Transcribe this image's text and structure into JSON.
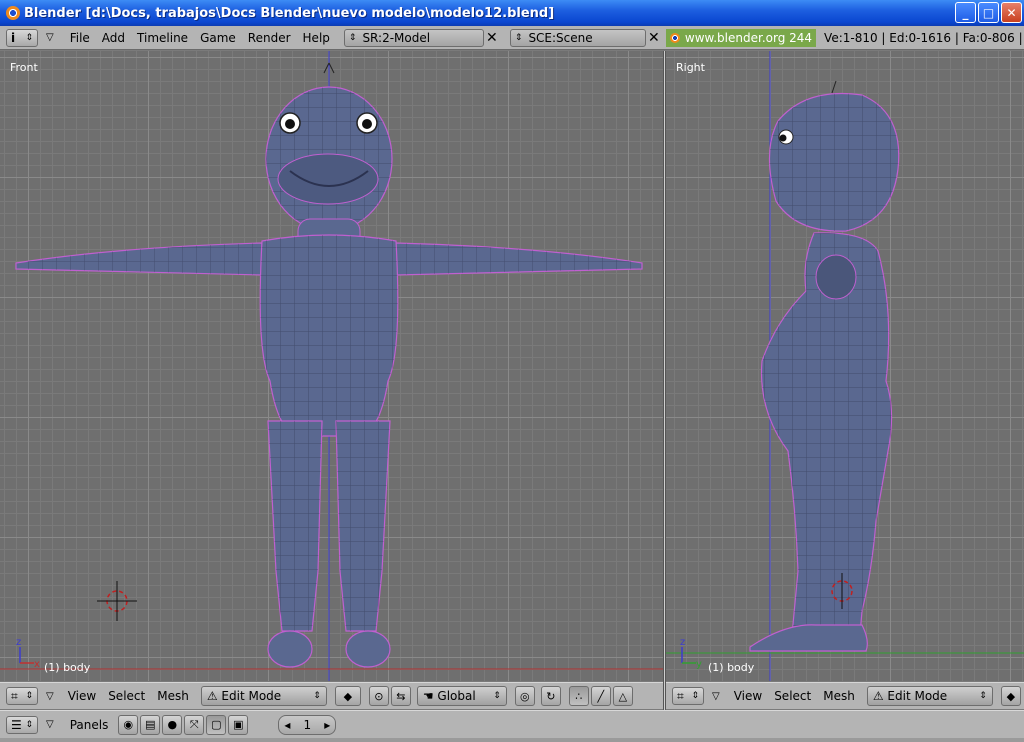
{
  "window": {
    "title": "Blender [d:\\Docs, trabajos\\Docs Blender\\nuevo modelo\\modelo12.blend]",
    "minimize": "_",
    "maximize": "□",
    "close": "✕"
  },
  "topheader": {
    "info_icon": "i",
    "menus": [
      "File",
      "Add",
      "Timeline",
      "Game",
      "Render",
      "Help"
    ],
    "screen_field": "SR:2-Model",
    "scene_field": "SCE:Scene",
    "url": "www.blender.org 244",
    "stats": "Ve:1-810 | Ed:0-1616 | Fa:0-806 |"
  },
  "viewports": {
    "front": {
      "label": "Front",
      "object": "(1) body"
    },
    "right": {
      "label": "Right",
      "object": "(1) body"
    }
  },
  "view_header_left": {
    "menus": [
      "View",
      "Select",
      "Mesh"
    ],
    "mode": "Edit Mode",
    "orientation": "Global"
  },
  "view_header_right": {
    "menus": [
      "View",
      "Select",
      "Mesh"
    ],
    "mode": "Edit Mode"
  },
  "buttons_header": {
    "panels_label": "Panels",
    "frame_value": "1"
  },
  "colors": {
    "mesh": "#5a6890",
    "wire": "#c060d0",
    "accent": "#7aa84a",
    "title_bar": "#0a46d0"
  }
}
